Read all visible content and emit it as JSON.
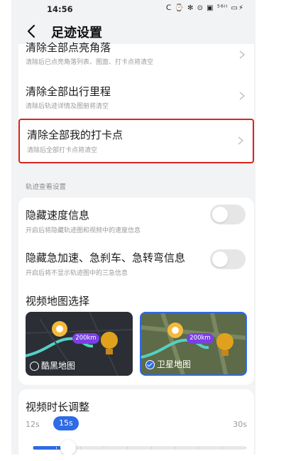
{
  "status_bar": {
    "time": "14:56",
    "icons_text": "ᑕ ⌚ ✻ ⊙ ▣ ⁵⁶ᴵˡ ▭⚡",
    "battery": "33"
  },
  "header": {
    "title": "足迹设置"
  },
  "trip_section": {
    "rows": [
      {
        "title": "清除全部点亮角落",
        "subtitle": "清除后已点亮角落列表、图面、打卡点将清空"
      },
      {
        "title": "清除全部出行里程",
        "subtitle": "清除后轨迹详情及图册将清空"
      },
      {
        "title": "清除全部我的打卡点",
        "subtitle": "清除后全部打卡点将清空"
      }
    ]
  },
  "track_view": {
    "section_label": "轨迹查看设置",
    "hide_speed": {
      "title": "隐藏速度信息",
      "subtitle": "开启后将隐藏轨迹图和视频中的速度信息",
      "enabled": false
    },
    "hide_events": {
      "title": "隐藏急加速、急刹车、急转弯信息",
      "subtitle": "开启后将不显示轨迹图中的三急信息",
      "enabled": false
    },
    "map_choice": {
      "title": "视频地图选择",
      "options": [
        {
          "label": "酷黑地图",
          "selected": false,
          "badge": "200km"
        },
        {
          "label": "卫星地图",
          "selected": true,
          "badge": "200km"
        }
      ]
    }
  },
  "duration": {
    "title": "视频时长调整",
    "min_label": "12s",
    "max_label": "30s",
    "value_label": "15s",
    "min": 12,
    "max": 30,
    "value": 15
  },
  "colors": {
    "accent": "#2e6be6",
    "highlight_border": "#d8261c",
    "badge": "#7b3fe4"
  }
}
